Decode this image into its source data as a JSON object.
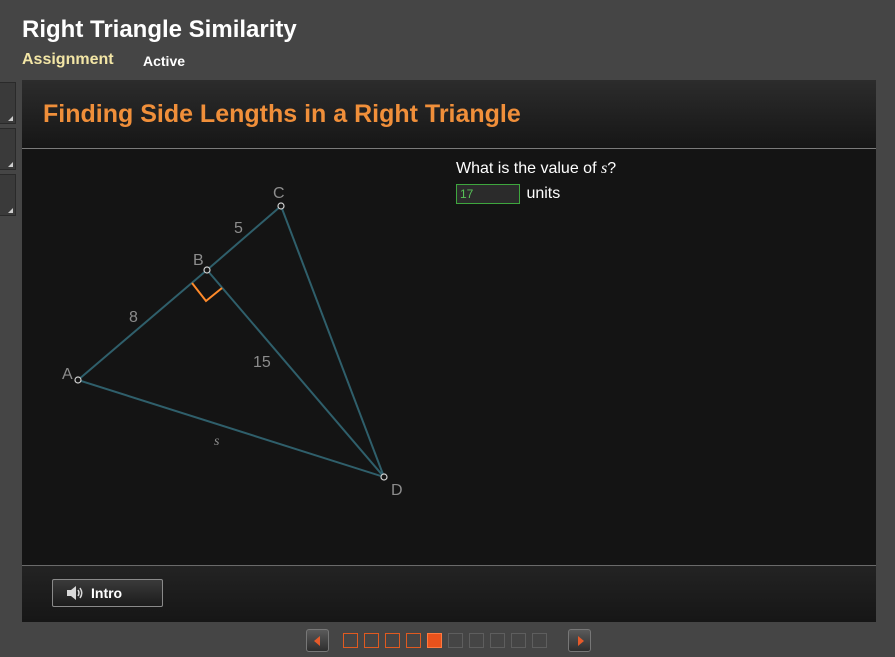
{
  "header": {
    "title": "Right Triangle Similarity",
    "assignment_label": "Assignment",
    "status": "Active"
  },
  "lesson": {
    "title": "Finding Side Lengths in a Right Triangle"
  },
  "question": {
    "prompt_before": "What is the value of ",
    "variable": "s",
    "prompt_after": "?",
    "answer_value": "17",
    "units_label": "units"
  },
  "diagram": {
    "points": {
      "A": "A",
      "B": "B",
      "C": "C",
      "D": "D"
    },
    "labels": {
      "AB": "8",
      "BC": "5",
      "BD": "15",
      "AD": "s"
    },
    "colors": {
      "lines": "#2f5f6b",
      "right_angle": "#ff8a2a"
    }
  },
  "footer": {
    "intro_label": "Intro"
  },
  "pager": {
    "states": [
      "done",
      "done",
      "done",
      "done",
      "current",
      "todo",
      "todo",
      "todo",
      "todo",
      "todo"
    ]
  },
  "colors": {
    "accent": "#f08f3a",
    "assignment": "#f3e6a6",
    "input_border": "#3ea63e",
    "input_text": "#57c157",
    "pager_done": "#e05a20"
  }
}
